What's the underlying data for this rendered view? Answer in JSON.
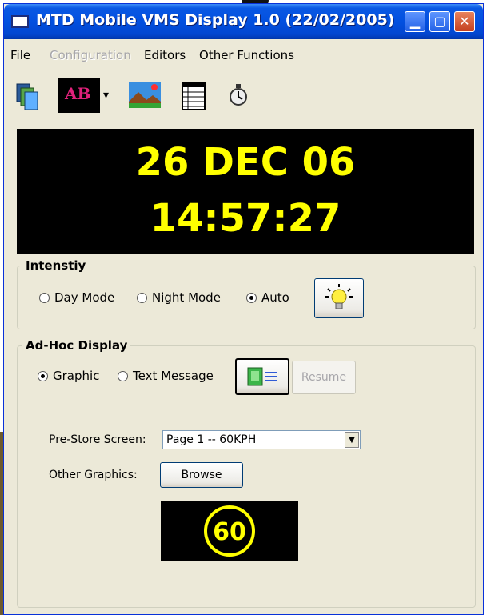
{
  "window": {
    "title": "MTD Mobile VMS Display 1.0 (22/02/2005)",
    "controls": {
      "minimize": "▁",
      "maximize": "▢",
      "close": "✕"
    }
  },
  "menu": {
    "items": [
      {
        "label": "File",
        "enabled": true
      },
      {
        "label": "Configuration",
        "enabled": false
      },
      {
        "label": "Editors",
        "enabled": true
      },
      {
        "label": "Other Functions",
        "enabled": true
      }
    ]
  },
  "toolbar": {
    "icons": [
      "copy-pages-icon",
      "font-color-icon",
      "dropdown-arrow-icon",
      "picture-icon",
      "table-icon",
      "stopwatch-icon"
    ],
    "font_sample_text": "AB",
    "dropdown_glyph": "▾"
  },
  "display": {
    "line1": "26 DEC 06",
    "line2": "14:57:27",
    "text_color": "#ffff00",
    "background": "#000000"
  },
  "intensity": {
    "legend": "Intenstiy",
    "options": [
      {
        "label": "Day Mode",
        "checked": false
      },
      {
        "label": "Night Mode",
        "checked": false
      },
      {
        "label": "Auto",
        "checked": true
      }
    ],
    "bulb_icon": "light-bulb-icon"
  },
  "adhoc": {
    "legend": "Ad-Hoc Display",
    "options": [
      {
        "label": "Graphic",
        "checked": true
      },
      {
        "label": "Text Message",
        "checked": false
      }
    ],
    "send_icon": "send-to-sign-icon",
    "resume_label": "Resume",
    "prestore_label": "Pre-Store Screen:",
    "prestore_value": "Page 1 -- 60KPH",
    "other_label": "Other Graphics:",
    "browse_label": "Browse",
    "preview_text": "60"
  }
}
